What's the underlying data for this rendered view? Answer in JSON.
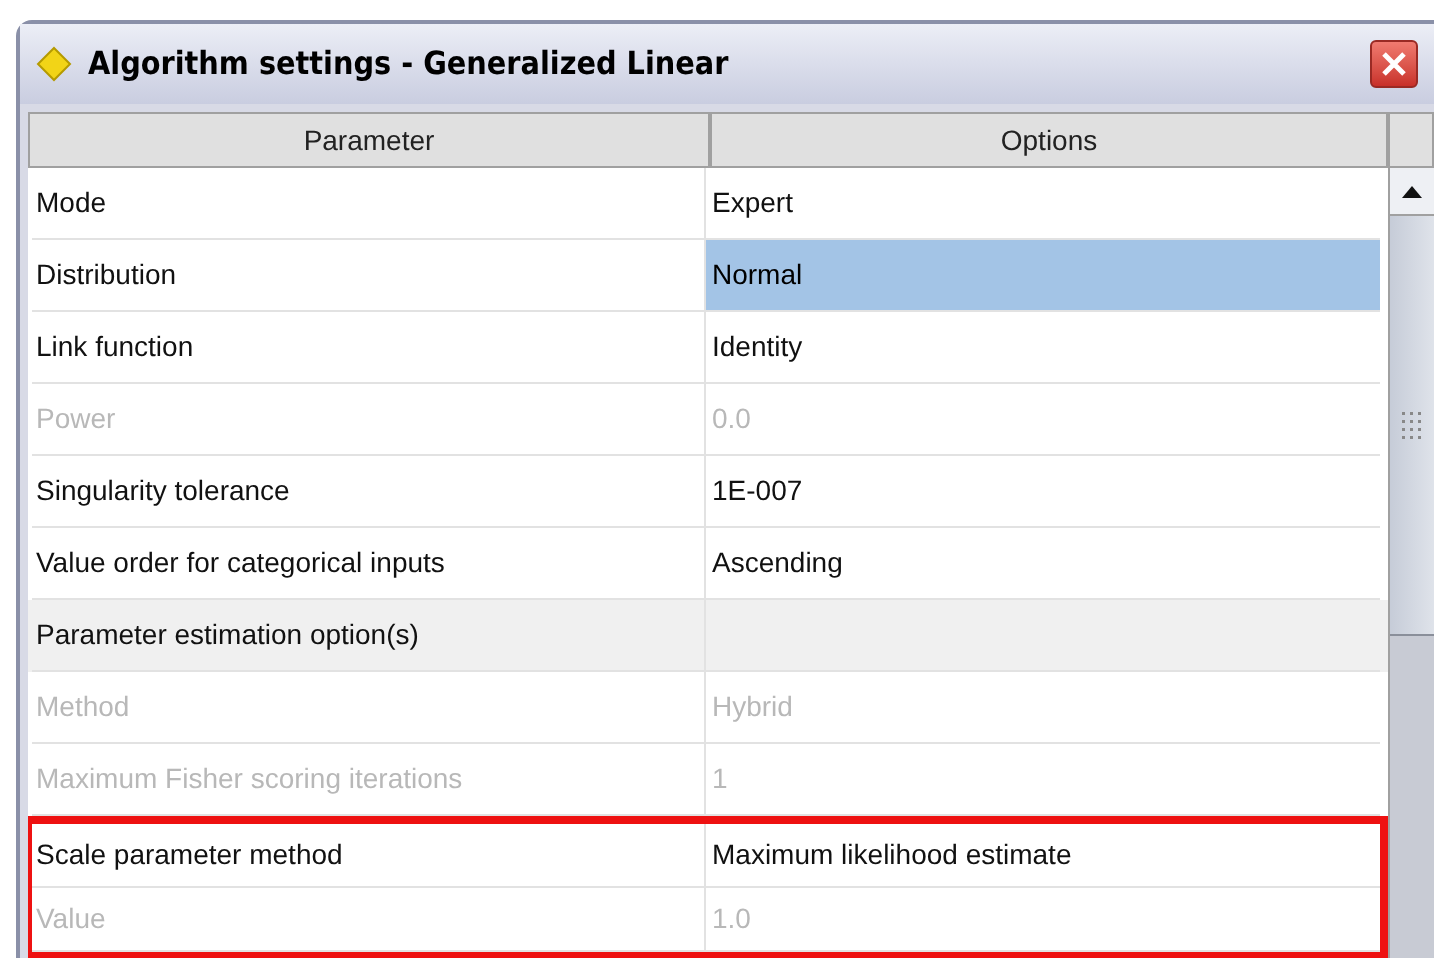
{
  "window": {
    "title": "Algorithm settings - Generalized Linear"
  },
  "table": {
    "columns": [
      "Parameter",
      "Options"
    ],
    "rows": [
      {
        "kind": "setting",
        "parameter": "Mode",
        "option": "Expert",
        "disabled": false,
        "selected": false,
        "highlighted": false
      },
      {
        "kind": "setting",
        "parameter": "Distribution",
        "option": "Normal",
        "disabled": false,
        "selected": true,
        "highlighted": false
      },
      {
        "kind": "setting",
        "parameter": "Link function",
        "option": "Identity",
        "disabled": false,
        "selected": false,
        "highlighted": false
      },
      {
        "kind": "setting",
        "parameter": "Power",
        "option": "0.0",
        "disabled": true,
        "selected": false,
        "highlighted": false
      },
      {
        "kind": "setting",
        "parameter": "Singularity tolerance",
        "option": "1E-007",
        "disabled": false,
        "selected": false,
        "highlighted": false
      },
      {
        "kind": "setting",
        "parameter": "Value order for categorical inputs",
        "option": "Ascending",
        "disabled": false,
        "selected": false,
        "highlighted": false
      },
      {
        "kind": "section",
        "parameter": "Parameter estimation option(s)",
        "disabled": false,
        "highlighted": false
      },
      {
        "kind": "setting",
        "parameter": "Method",
        "option": "Hybrid",
        "disabled": true,
        "selected": false,
        "highlighted": false
      },
      {
        "kind": "setting",
        "parameter": "Maximum Fisher scoring iterations",
        "option": "1",
        "disabled": true,
        "selected": false,
        "highlighted": false
      },
      {
        "kind": "setting",
        "parameter": "Scale parameter method",
        "option": "Maximum likelihood estimate",
        "disabled": false,
        "selected": false,
        "highlighted": true
      },
      {
        "kind": "setting",
        "parameter": "Value",
        "option": "1.0",
        "disabled": true,
        "selected": false,
        "highlighted": true
      }
    ]
  }
}
